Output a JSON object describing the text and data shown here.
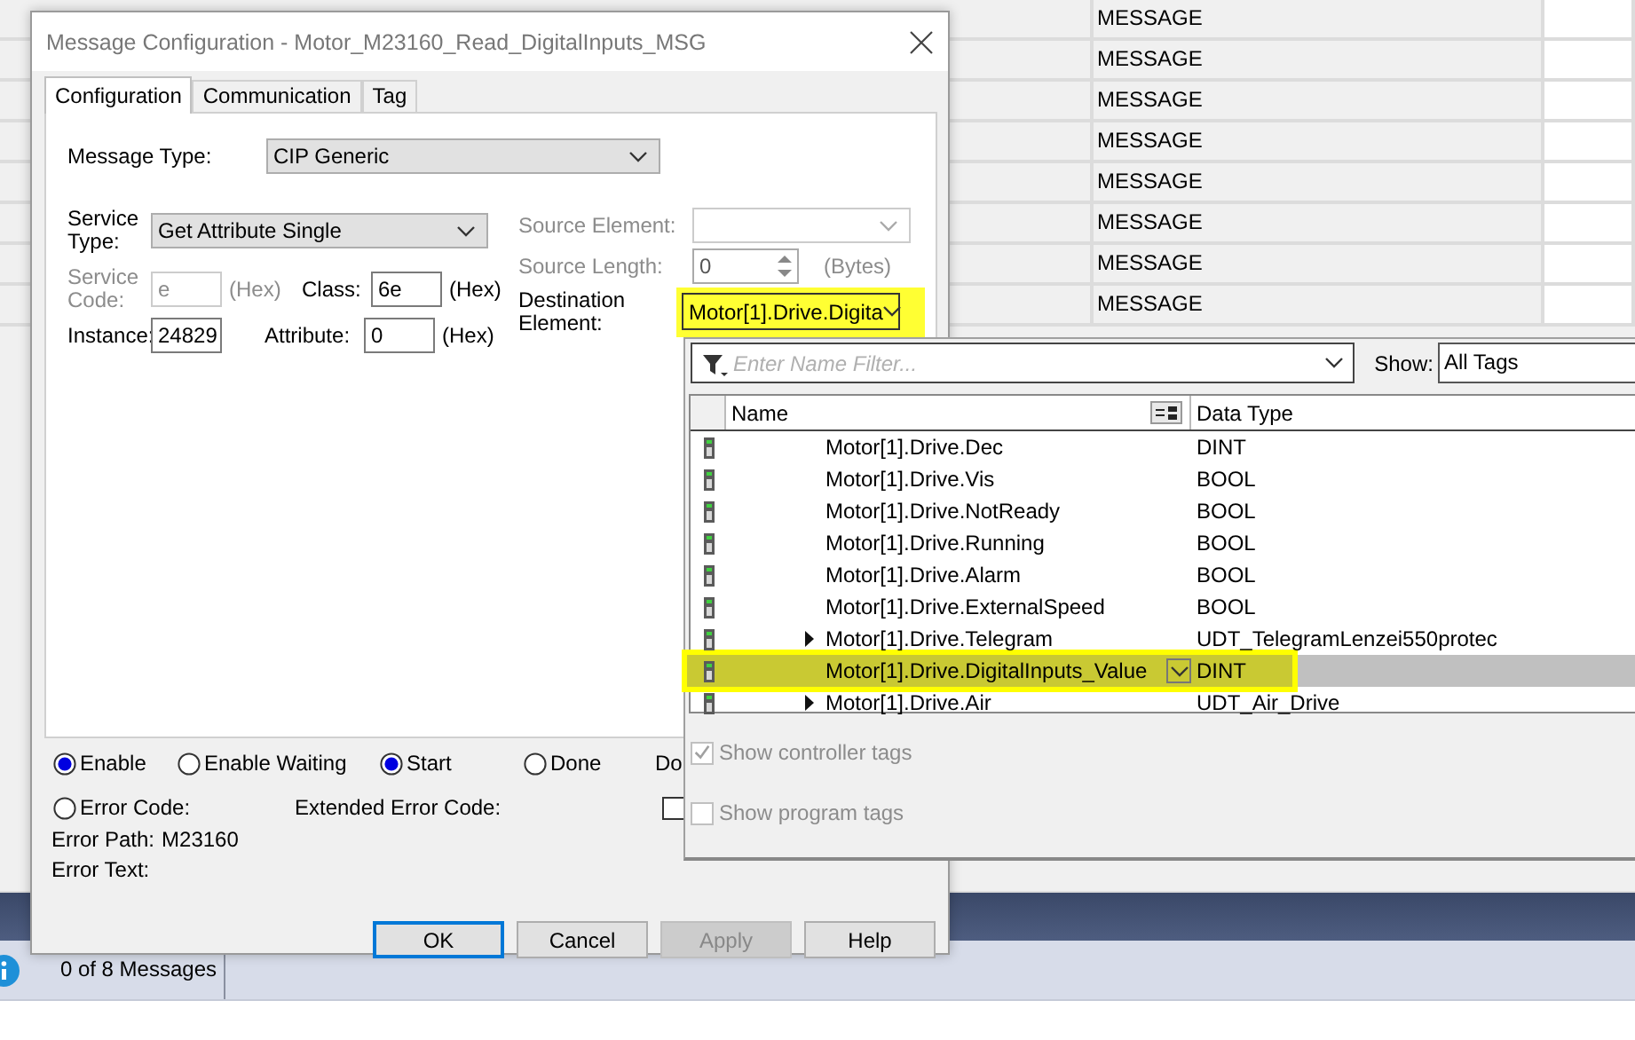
{
  "background_grid": {
    "rows": [
      {
        "type": "MESSAGE"
      },
      {
        "type": "MESSAGE"
      },
      {
        "type": "MESSAGE"
      },
      {
        "type": "MESSAGE"
      },
      {
        "type": "MESSAGE"
      },
      {
        "type": "MESSAGE"
      },
      {
        "type": "MESSAGE"
      },
      {
        "type": "MESSAGE"
      }
    ]
  },
  "status_bar": {
    "messages": "0 of 8 Messages"
  },
  "dialog": {
    "title": "Message Configuration - Motor_M23160_Read_DigitalInputs_MSG",
    "tabs": [
      {
        "label": "Configuration",
        "selected": true
      },
      {
        "label": "Communication",
        "selected": false
      },
      {
        "label": "Tag",
        "selected": false
      }
    ],
    "message_type": {
      "label": "Message Type:",
      "value": "CIP Generic"
    },
    "service_type": {
      "label": "Service Type:",
      "value": "Get Attribute Single"
    },
    "service_code": {
      "label": "Service Code:",
      "value": "e",
      "unit": "(Hex)",
      "disabled": true
    },
    "class": {
      "label": "Class:",
      "value": "6e",
      "unit": "(Hex)"
    },
    "instance": {
      "label": "Instance:",
      "value": "24829"
    },
    "attribute": {
      "label": "Attribute:",
      "value": "0",
      "unit": "(Hex)"
    },
    "source_element": {
      "label": "Source Element:",
      "disabled": true
    },
    "source_length": {
      "label": "Source Length:",
      "value": "0",
      "unit": "(Bytes)",
      "disabled": true
    },
    "destination_element": {
      "label": "Destination Element:",
      "value": "Motor[1].Drive.Digita",
      "highlighted": true
    },
    "status_indicators": [
      {
        "kind": "radio",
        "label": "Enable",
        "on": true
      },
      {
        "kind": "radio",
        "label": "Enable Waiting",
        "on": false
      },
      {
        "kind": "radio",
        "label": "Start",
        "on": true
      },
      {
        "kind": "radio",
        "label": "Done",
        "on": false
      },
      {
        "kind": "text",
        "label": "Do"
      }
    ],
    "error_code": {
      "label": "Error Code:",
      "on": false
    },
    "extended_error_code": {
      "label": "Extended Error Code:"
    },
    "timed_out_checkbox": {
      "checked": false
    },
    "error_path": {
      "label": "Error Path:",
      "value": "M23160"
    },
    "error_text": {
      "label": "Error Text:"
    },
    "buttons": [
      {
        "label": "OK",
        "kind": "default"
      },
      {
        "label": "Cancel",
        "kind": "normal"
      },
      {
        "label": "Apply",
        "kind": "disabled"
      },
      {
        "label": "Help",
        "kind": "normal"
      }
    ]
  },
  "tag_browser": {
    "filter": {
      "placeholder": "Enter Name Filter..."
    },
    "show": {
      "label": "Show:",
      "value": "All Tags"
    },
    "columns": [
      "Name",
      "Data Type"
    ],
    "rows": [
      {
        "name": "Motor[1].Drive.Dec",
        "data_type": "DINT",
        "expandable": false,
        "selected": false,
        "highlighted": false
      },
      {
        "name": "Motor[1].Drive.Vis",
        "data_type": "BOOL",
        "expandable": false,
        "selected": false,
        "highlighted": false
      },
      {
        "name": "Motor[1].Drive.NotReady",
        "data_type": "BOOL",
        "expandable": false,
        "selected": false,
        "highlighted": false
      },
      {
        "name": "Motor[1].Drive.Running",
        "data_type": "BOOL",
        "expandable": false,
        "selected": false,
        "highlighted": false
      },
      {
        "name": "Motor[1].Drive.Alarm",
        "data_type": "BOOL",
        "expandable": false,
        "selected": false,
        "highlighted": false
      },
      {
        "name": "Motor[1].Drive.ExternalSpeed",
        "data_type": "BOOL",
        "expandable": false,
        "selected": false,
        "highlighted": false
      },
      {
        "name": "Motor[1].Drive.Telegram",
        "data_type": "UDT_TelegramLenzei550protec",
        "expandable": true,
        "selected": false,
        "highlighted": false
      },
      {
        "name": "Motor[1].Drive.DigitalInputs_Value",
        "data_type": "DINT",
        "expandable": false,
        "selected": true,
        "highlighted": true
      },
      {
        "name": "Motor[1].Drive.Air",
        "data_type": "UDT_Air_Drive",
        "expandable": true,
        "selected": false,
        "highlighted": false
      }
    ],
    "options": [
      {
        "label": "Show controller tags",
        "checked": true,
        "disabled": true
      },
      {
        "label": "Show program tags",
        "checked": false,
        "disabled": true
      }
    ]
  }
}
